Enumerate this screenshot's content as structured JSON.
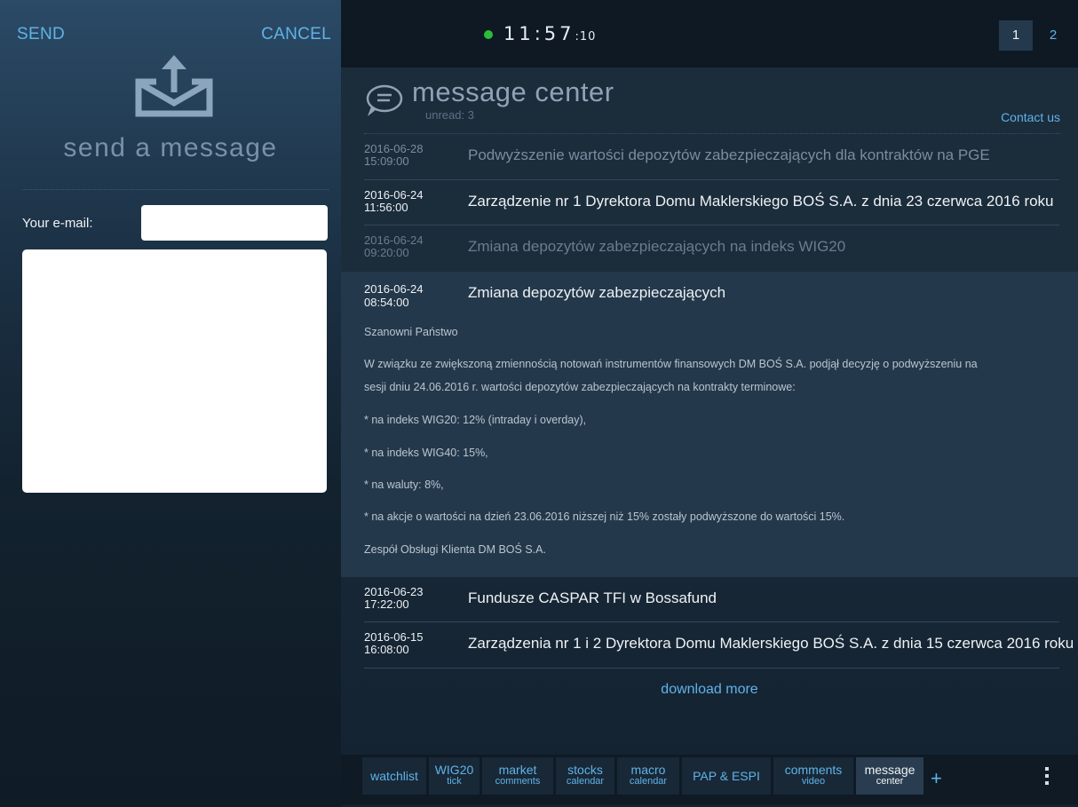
{
  "compose": {
    "send_label": "SEND",
    "cancel_label": "CANCEL",
    "title": "send a message",
    "email_label": "Your e-mail:",
    "email_value": "",
    "message_value": ""
  },
  "status": {
    "clock_hm": "11:57",
    "clock_sec": ":10",
    "connection_color": "#2dbb3a",
    "pages": [
      "1",
      "2"
    ],
    "active_page": "1"
  },
  "message_center": {
    "title": "message center",
    "unread": "unread: 3",
    "contact_label": "Contact us",
    "messages": [
      {
        "date": "2016-06-28",
        "time": "15:09:00",
        "title": "Podwyższenie wartości depozytów zabezpieczających dla kontraktów na PGE"
      },
      {
        "date": "2016-06-24",
        "time": "11:56:00",
        "title": "Zarządzenie nr 1 Dyrektora Domu Maklerskiego BOŚ S.A. z dnia 23 czerwca 2016 roku"
      },
      {
        "date": "2016-06-24",
        "time": "09:20:00",
        "title": "Zmiana depozytów zabezpieczających na indeks WIG20"
      }
    ],
    "expanded": {
      "date": "2016-06-24",
      "time": "08:54:00",
      "title": "Zmiana depozytów zabezpieczających",
      "greeting": "Szanowni Państwo",
      "intro_line1": "W związku ze zwiększoną zmiennością notowań instrumentów finansowych DM BOŚ S.A. podjął decyzję o podwyższeniu na",
      "intro_line2": "sesji dniu 24.06.2016 r. wartości depozytów zabezpieczających na kontrakty terminowe:",
      "items": [
        "* na indeks WIG20: 12% (intraday i overday),",
        "* na indeks WIG40: 15%,",
        "* na waluty: 8%,",
        "* na akcje o wartości na dzień 23.06.2016 niższej niż 15% zostały podwyższone do wartości 15%."
      ],
      "signature": "Zespół Obsługi Klienta DM BOŚ S.A."
    },
    "messages_after": [
      {
        "date": "2016-06-23",
        "time": "17:22:00",
        "title": "Fundusze CASPAR TFI w Bossafund"
      },
      {
        "date": "2016-06-15",
        "time": "16:08:00",
        "title": "Zarządzenia nr 1 i 2 Dyrektora Domu Maklerskiego BOŚ S.A. z dnia 15 czerwca 2016 roku"
      }
    ],
    "download_more": "download more"
  },
  "tabs": [
    {
      "l1": "watchlist",
      "l2": ""
    },
    {
      "l1": "WIG20",
      "l2": "tick"
    },
    {
      "l1": "market",
      "l2": "comments"
    },
    {
      "l1": "stocks",
      "l2": "calendar"
    },
    {
      "l1": "macro",
      "l2": "calendar"
    },
    {
      "l1": "PAP & ESPI",
      "l2": ""
    },
    {
      "l1": "comments",
      "l2": "video"
    },
    {
      "l1": "message",
      "l2": "center"
    }
  ],
  "tab_plus": "+",
  "icons": {
    "compose": "outbox-upload-icon",
    "message_center": "speech-bubble-icon",
    "more": "vertical-dots-icon"
  }
}
